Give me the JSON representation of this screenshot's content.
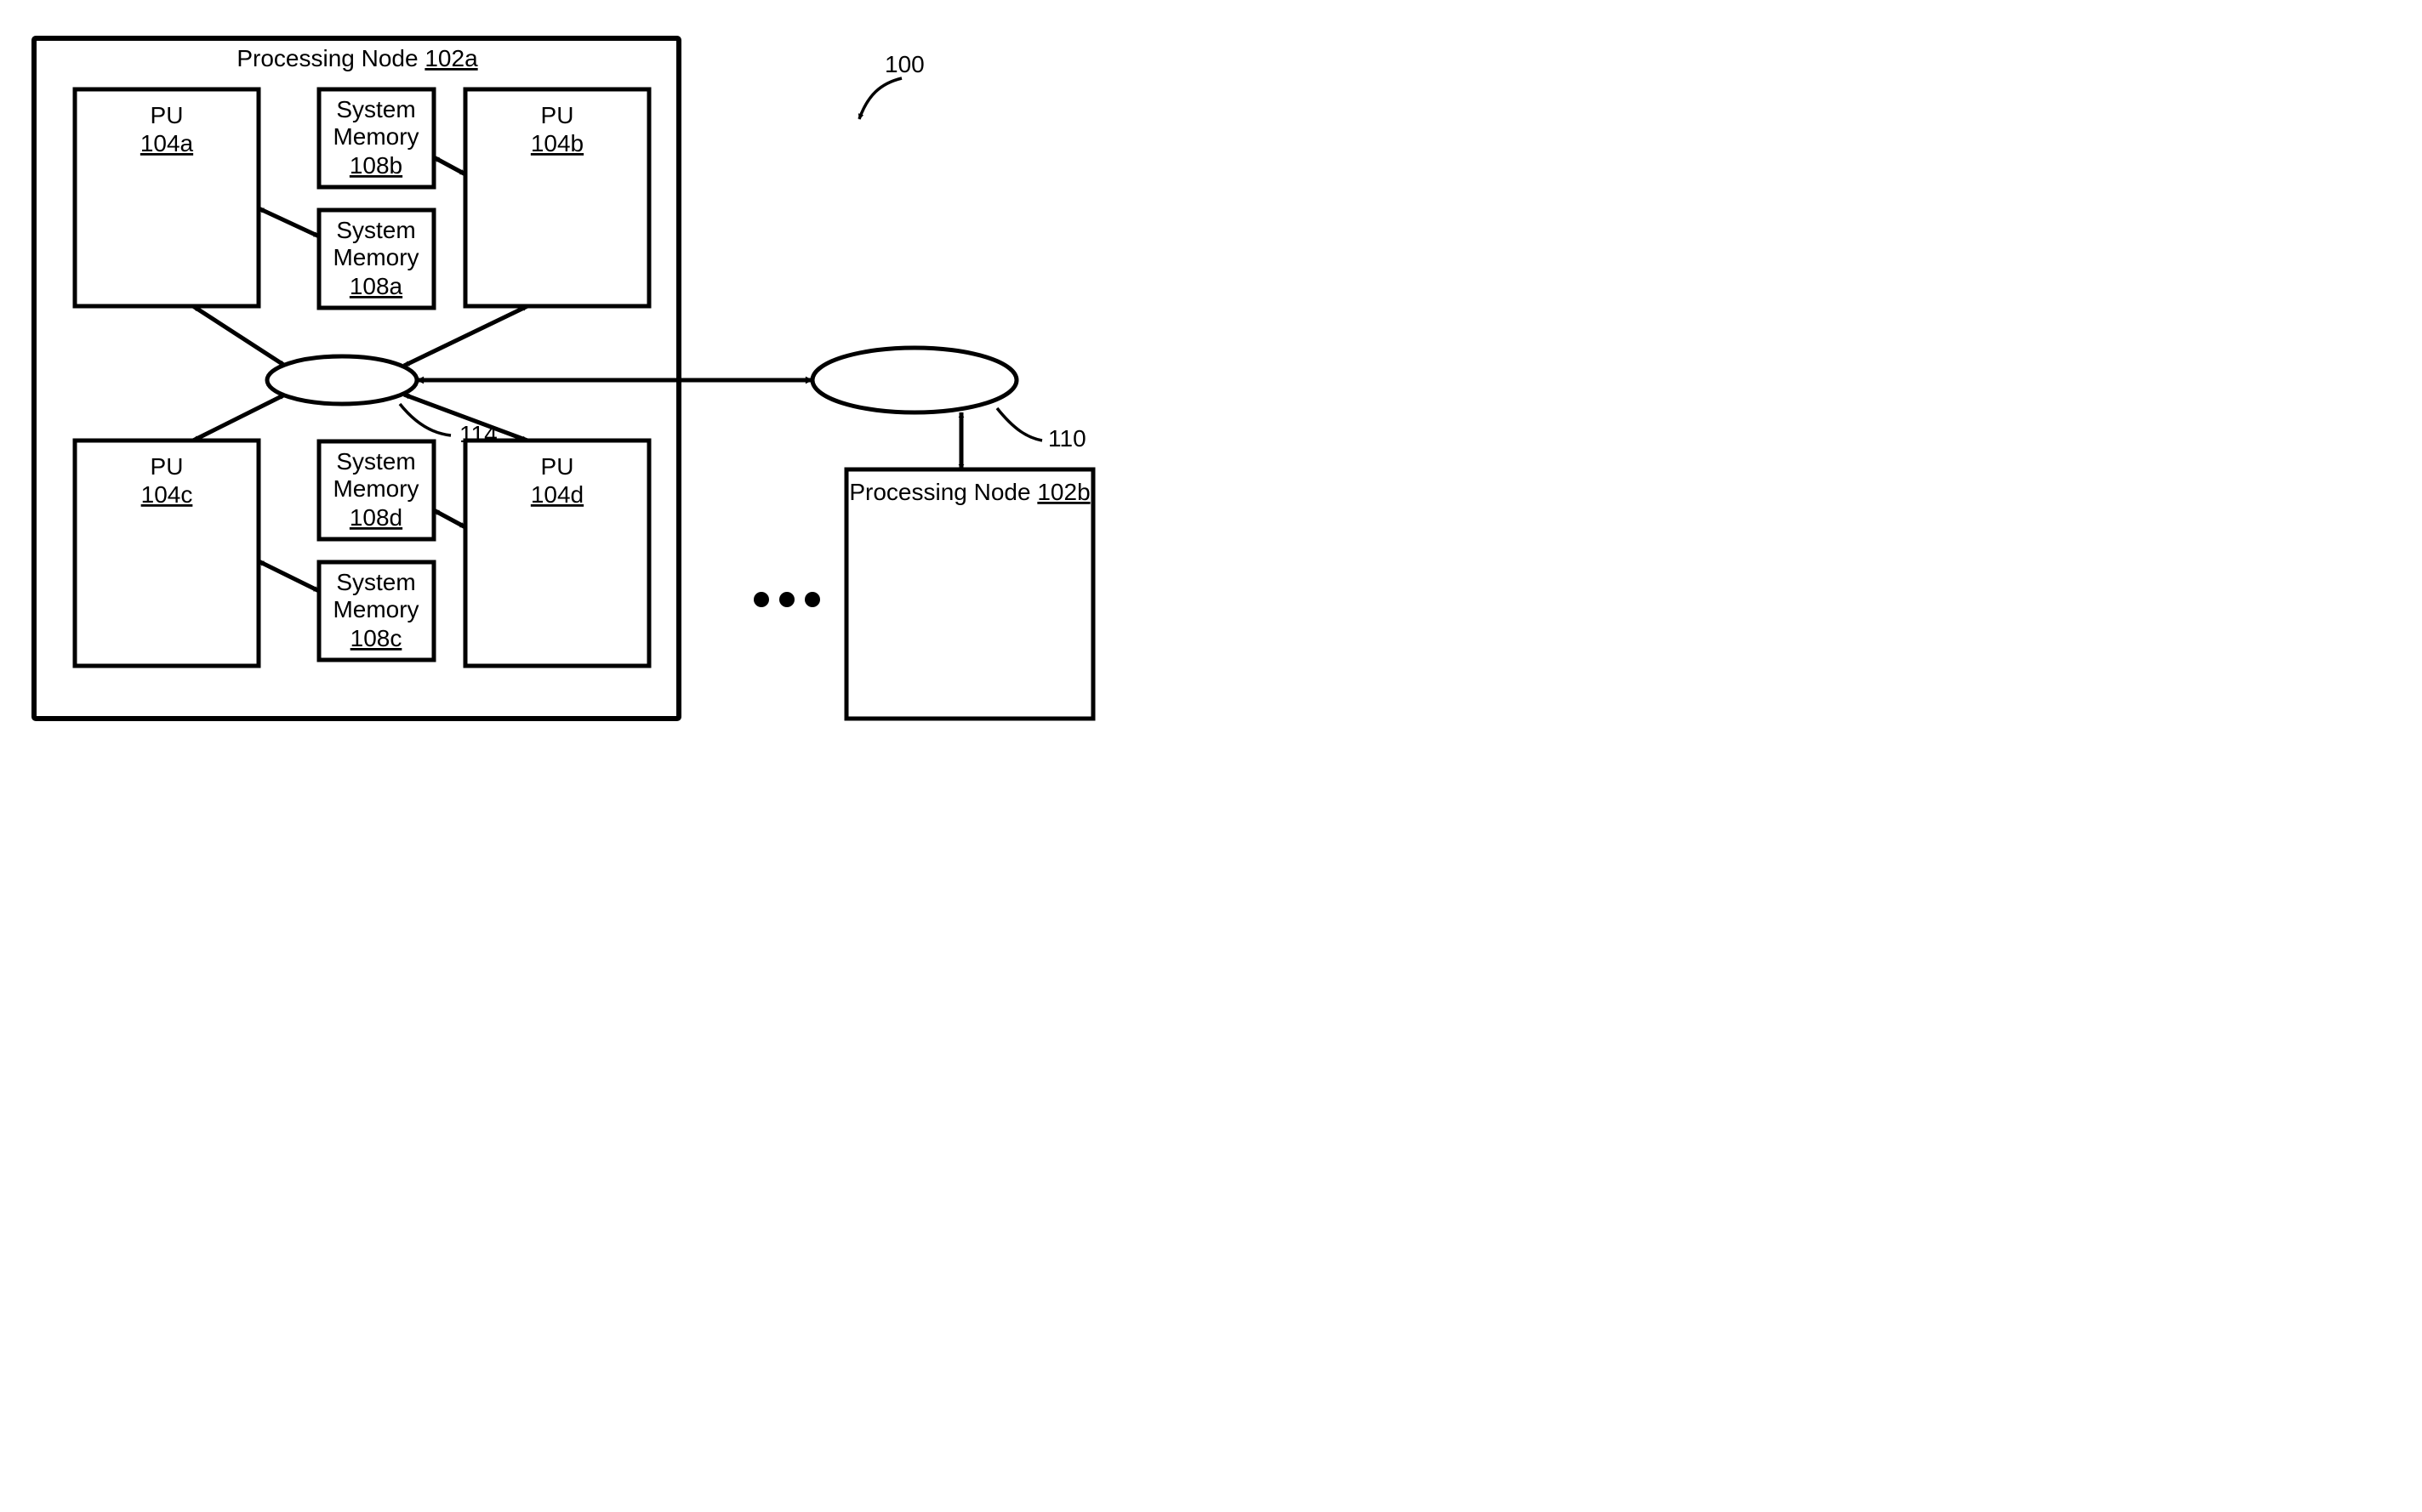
{
  "figureLabel": "100",
  "nodeA": {
    "title_prefix": "Processing Node ",
    "title_ref": "102a",
    "pu": [
      {
        "label": "PU",
        "ref": "104a"
      },
      {
        "label": "PU",
        "ref": "104b"
      },
      {
        "label": "PU",
        "ref": "104c"
      },
      {
        "label": "PU",
        "ref": "104d"
      }
    ],
    "mem": [
      {
        "line1": "System",
        "line2": "Memory",
        "ref": "108a"
      },
      {
        "line1": "System",
        "line2": "Memory",
        "ref": "108b"
      },
      {
        "line1": "System",
        "line2": "Memory",
        "ref": "108c"
      },
      {
        "line1": "System",
        "line2": "Memory",
        "ref": "108d"
      }
    ],
    "localInterconnectRef": "114"
  },
  "systemInterconnectRef": "110",
  "nodeB": {
    "title_prefix": "Processing Node ",
    "title_ref": "102b"
  }
}
